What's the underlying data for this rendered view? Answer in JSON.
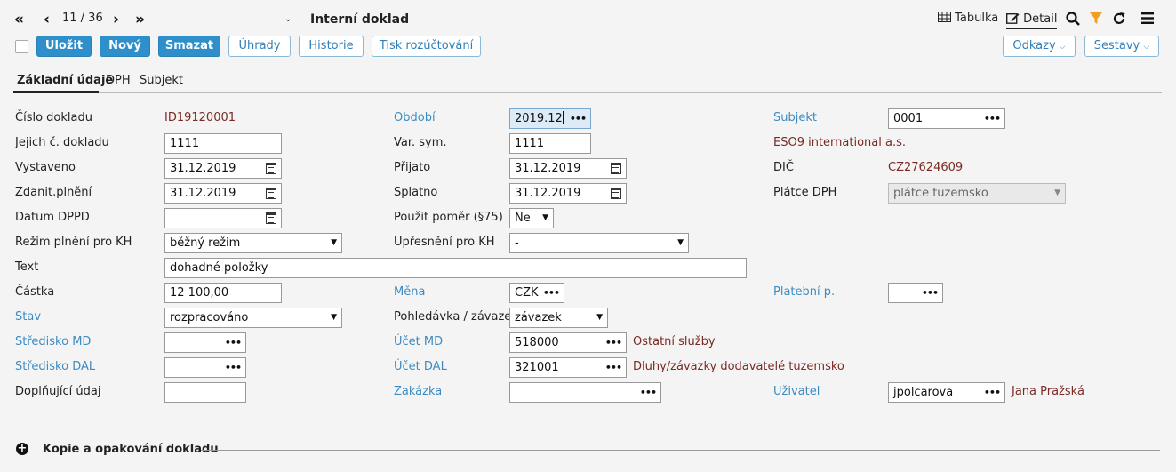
{
  "nav": {
    "first": "«",
    "prev": "‹",
    "pager": "11 / 36",
    "next": "›",
    "last": "»",
    "caret": "⌄",
    "title": "Interní doklad"
  },
  "toolbar": {
    "save": "Uložit",
    "new": "Nový",
    "delete": "Smazat",
    "payments": "Úhrady",
    "history": "Historie",
    "print": "Tisk rozúčtování",
    "links": "Odkazy",
    "reports": "Sestavy"
  },
  "view": {
    "table": "Tabulka",
    "detail": "Detail"
  },
  "tabs": [
    "Základní údaje",
    "DPH",
    "Subjekt"
  ],
  "form": {
    "col1": {
      "cislo_lbl": "Číslo dokladu",
      "cislo_val": "ID19120001",
      "jejich_lbl": "Jejich č. dokladu",
      "jejich_val": "1111",
      "vyst_lbl": "Vystaveno",
      "vyst_val": "31.12.2019",
      "zdan_lbl": "Zdanit.plnění",
      "zdan_val": "31.12.2019",
      "dppd_lbl": "Datum DPPD",
      "dppd_val": "",
      "rezim_lbl": "Režim plnění pro KH",
      "rezim_val": "běžný režim",
      "text_lbl": "Text",
      "text_val": "dohadné položky",
      "castka_lbl": "Částka",
      "castka_val": "12 100,00",
      "stav_lbl": "Stav",
      "stav_val": "rozpracováno",
      "smd_lbl": "Středisko MD",
      "smd_val": "",
      "sdal_lbl": "Středisko DAL",
      "sdal_val": "",
      "dopl_lbl": "Doplňující údaj",
      "dopl_val": ""
    },
    "col2": {
      "obdobi_lbl": "Období",
      "obdobi_val": "2019.12",
      "var_lbl": "Var. sym.",
      "var_val": "1111",
      "prij_lbl": "Přijato",
      "prij_val": "31.12.2019",
      "splat_lbl": "Splatno",
      "splat_val": "31.12.2019",
      "pomer_lbl": "Použit poměr (§75)",
      "pomer_val": "Ne",
      "upres_lbl": "Upřesnění pro KH",
      "upres_val": "-",
      "mena_lbl": "Měna",
      "mena_val": "CZK",
      "pohl_lbl": "Pohledávka / závazek",
      "pohl_val": "závazek",
      "umd_lbl": "Účet MD",
      "umd_val": "518000",
      "umd_desc": "Ostatní služby",
      "udal_lbl": "Účet DAL",
      "udal_val": "321001",
      "udal_desc": "Dluhy/závazky dodavatelé tuzemsko",
      "zak_lbl": "Zakázka",
      "zak_val": ""
    },
    "col3": {
      "subj_lbl": "Subjekt",
      "subj_val": "0001",
      "subj_name": "ESO9 international a.s.",
      "dic_lbl": "DIČ",
      "dic_val": "CZ27624609",
      "platce_lbl": "Plátce DPH",
      "platce_val": "plátce tuzemsko",
      "platp_lbl": "Platební p.",
      "platp_val": "",
      "uziv_lbl": "Uživatel",
      "uziv_val": "jpolcarova",
      "uziv_name": "Jana Pražská"
    }
  },
  "bottom": {
    "copy": "Kopie a opakování dokladu"
  },
  "colors": {
    "primary": "#2f8fca",
    "link": "#3e8bc1",
    "value": "#7a2a24",
    "filter": "#f0a020"
  }
}
